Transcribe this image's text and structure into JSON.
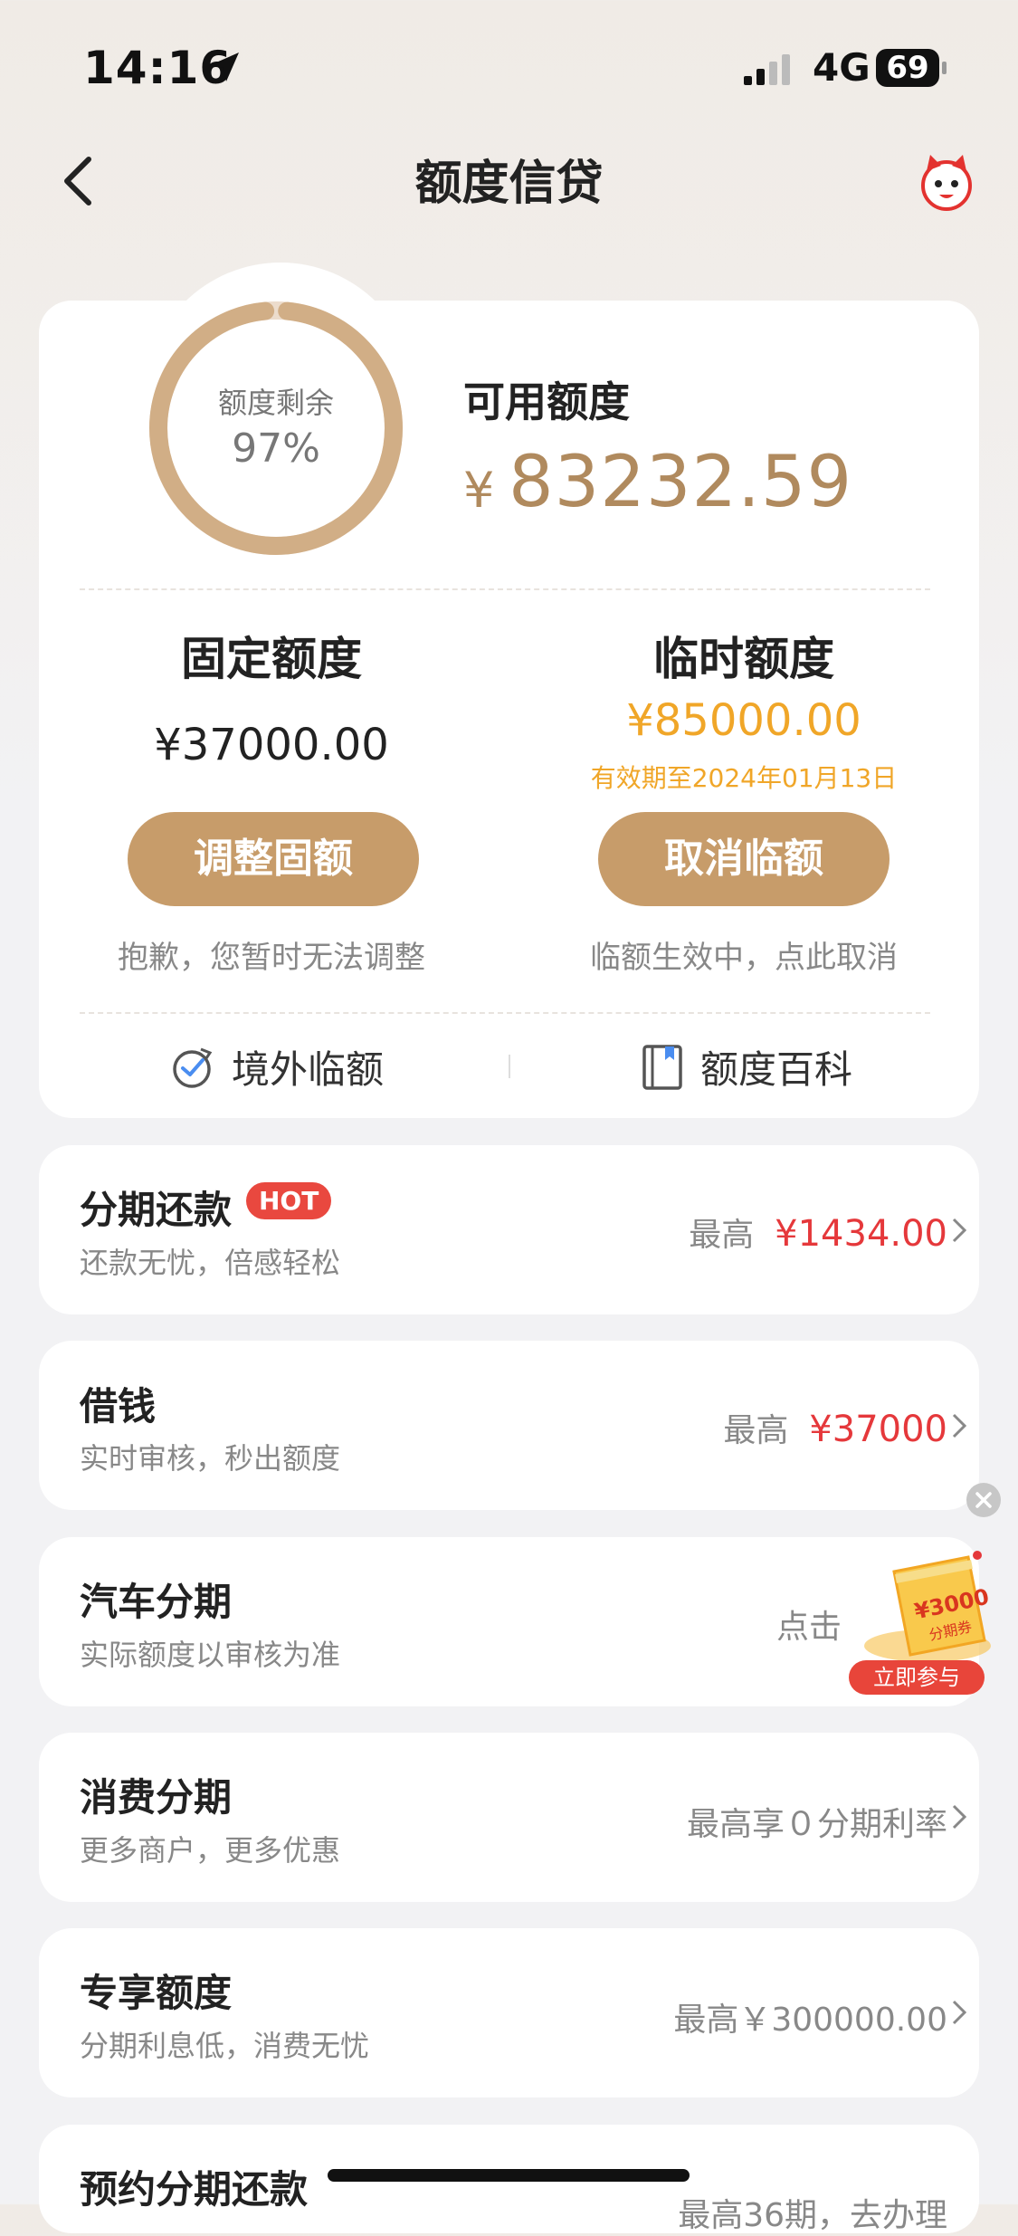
{
  "status_bar": {
    "time": "14:16",
    "network": "4G",
    "battery": "69"
  },
  "nav": {
    "title": "额度信贷"
  },
  "credit": {
    "ring_label": "额度剩余",
    "ring_percent": "97%",
    "ring_fraction": 0.97,
    "available_label": "可用额度",
    "currency_symbol": "¥",
    "available_amount": "83232.59"
  },
  "fixed": {
    "title": "固定额度",
    "amount": "¥37000.00",
    "button": "调整固额",
    "hint": "抱歉，您暂时无法调整"
  },
  "temporary": {
    "title": "临时额度",
    "amount": "¥85000.00",
    "valid_until": "有效期至2024年01月13日",
    "button": "取消临额",
    "hint": "临额生效中，点此取消"
  },
  "tools": {
    "overseas": "境外临额",
    "encyclopedia": "额度百科"
  },
  "products": [
    {
      "title": "分期还款",
      "badge": "HOT",
      "subtitle": "还款无忧，倍感轻松",
      "right_prefix": "最高",
      "right_value": "¥1434.00"
    },
    {
      "title": "借钱",
      "subtitle": "实时审核，秒出额度",
      "right_prefix": "最高",
      "right_value": "¥37000"
    },
    {
      "title": "汽车分期",
      "subtitle": "实际额度以审核为准",
      "right_prefix": "点击"
    },
    {
      "title": "消费分期",
      "subtitle": "更多商户，更多优惠",
      "right_prefix": "最高享０分期利率"
    },
    {
      "title": "专享额度",
      "subtitle": "分期利息低，消费无忧",
      "right_prefix": "最高￥300000.00"
    },
    {
      "title": "预约分期还款",
      "right_prefix": "最高36期，去办理"
    }
  ],
  "promo": {
    "coupon_amount": "¥3000",
    "coupon_label": "分期券",
    "button": "立即参与"
  },
  "colors": {
    "accent": "#c79c6a",
    "gold_text": "#b08a5e",
    "orange": "#f0a628",
    "red": "#e5383b"
  }
}
